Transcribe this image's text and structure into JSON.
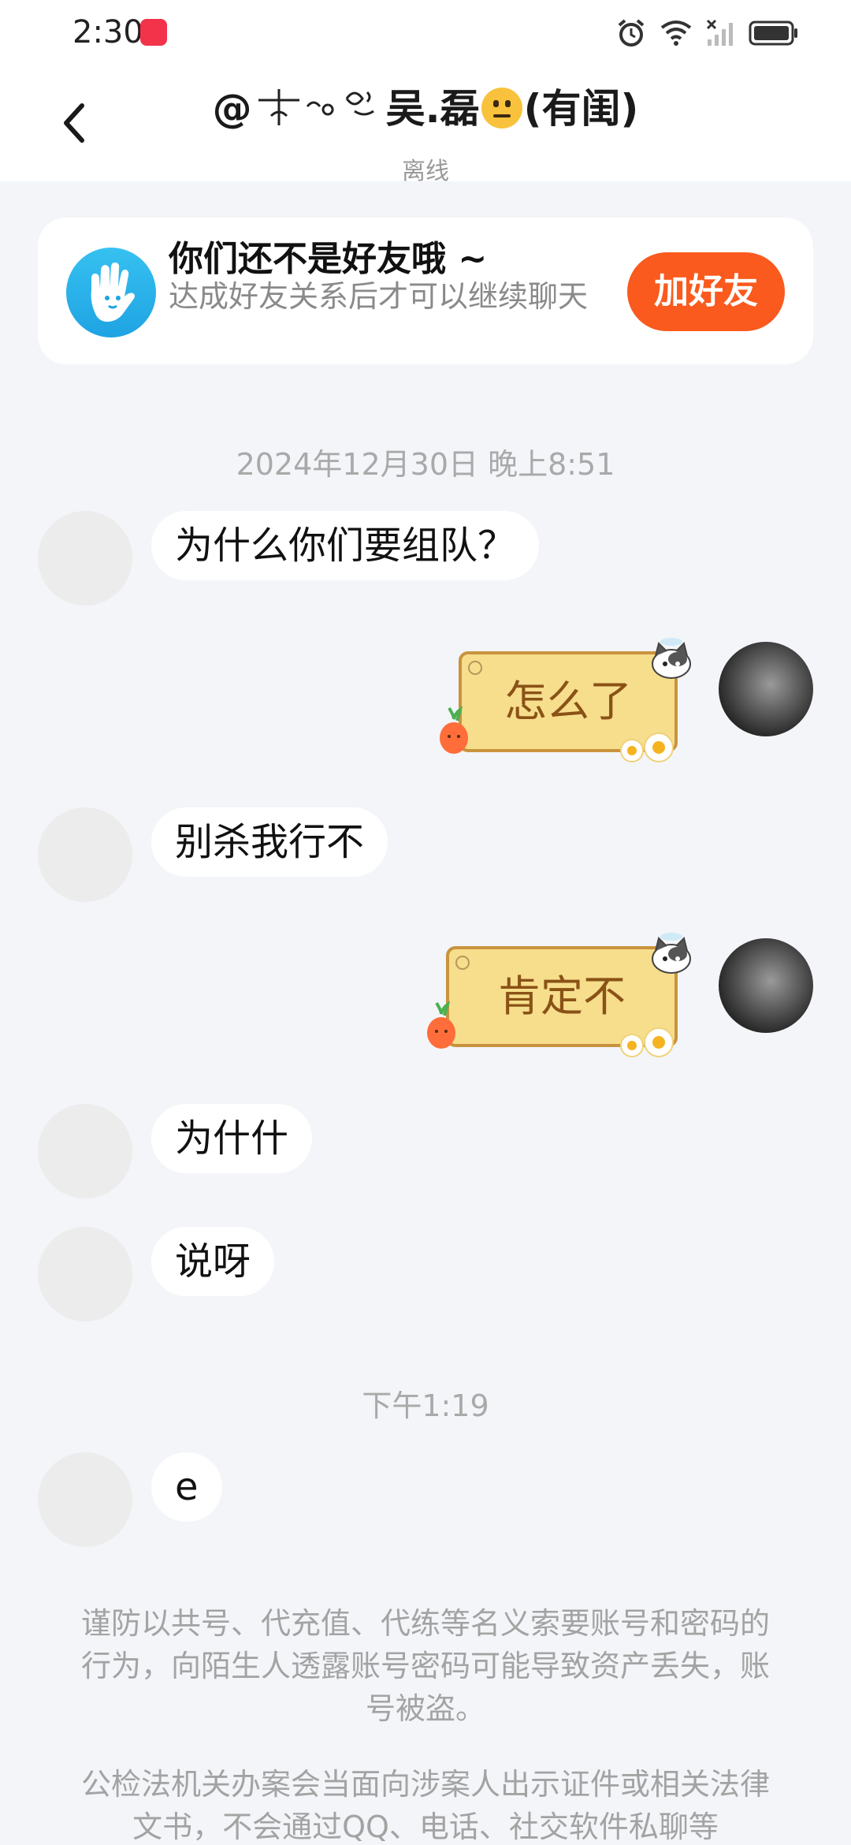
{
  "status_bar": {
    "time": "2:30"
  },
  "header": {
    "title_prefix": "@",
    "title_name": "吴.磊",
    "title_suffix": "(有闺)",
    "status": "离线"
  },
  "friend_card": {
    "title": "你们还不是好友哦 ~",
    "description": "达成好友关系后才可以继续聊天",
    "button_label": "加好友"
  },
  "messages": [
    {
      "type": "timestamp",
      "text": "2024年12月30日 晚上8:51"
    },
    {
      "type": "incoming",
      "text": "为什么你们要组队？"
    },
    {
      "type": "outgoing_sticker",
      "text": "怎么了"
    },
    {
      "type": "incoming",
      "text": "别杀我行不"
    },
    {
      "type": "outgoing_sticker",
      "text": "肯定不"
    },
    {
      "type": "incoming",
      "text": "为什什"
    },
    {
      "type": "incoming",
      "text": "说呀"
    },
    {
      "type": "timestamp",
      "text": "下午1:19"
    },
    {
      "type": "incoming",
      "text": "e"
    }
  ],
  "notices": [
    "谨防以共号、代充值、代练等名义索要账号和密码的行为，向陌生人透露账号密码可能导致资产丢失，账号被盗。",
    "公检法机关办案会当面向涉案人出示证件或相关法律文书，不会通过QQ、电话、社交软件私聊等"
  ],
  "colors": {
    "accent": "#fa5a1e",
    "background": "#f3f5f8",
    "sticker_fill": "#f6de8c"
  }
}
